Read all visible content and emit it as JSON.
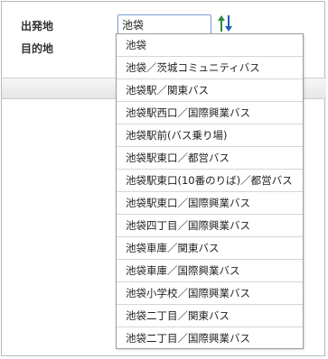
{
  "form": {
    "from_label": "出発地",
    "to_label": "目的地",
    "from_value": "池袋"
  },
  "suggestions": [
    "池袋",
    "池袋／茨城コミュニティバス",
    "池袋駅／関東バス",
    "池袋駅西口／国際興業バス",
    "池袋駅前(バス乗り場)",
    "池袋駅東口／都営バス",
    "池袋駅東口(10番のりば)／都営バス",
    "池袋駅東口／国際興業バス",
    "池袋四丁目／国際興業バス",
    "池袋車庫／関東バス",
    "池袋車庫／国際興業バス",
    "池袋小学校／国際興業バス",
    "池袋二丁目／関東バス",
    "池袋二丁目／国際興業バス"
  ],
  "colors": {
    "swap_up": "#2b8a3e",
    "swap_down": "#1f5fb4"
  }
}
